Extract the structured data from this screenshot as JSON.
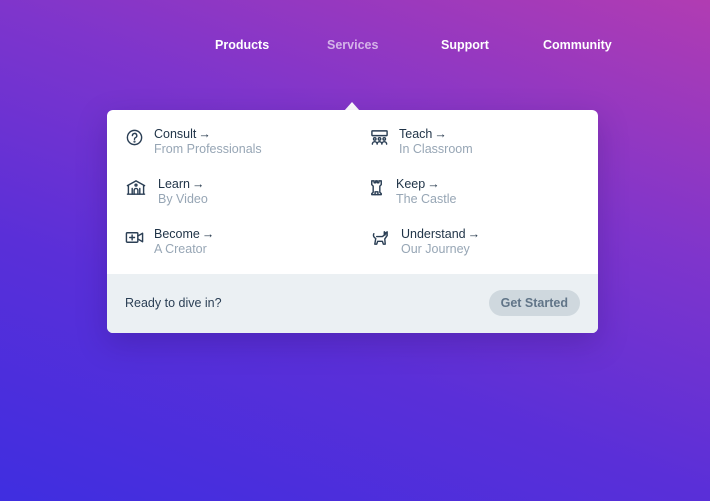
{
  "nav": {
    "items": [
      {
        "label": "Products"
      },
      {
        "label": "Services",
        "active": true
      },
      {
        "label": "Support"
      },
      {
        "label": "Community"
      }
    ]
  },
  "dropdown": {
    "items": [
      {
        "title": "Consult",
        "subtitle": "From Professionals",
        "icon": "question-circle-icon"
      },
      {
        "title": "Teach",
        "subtitle": "In Classroom",
        "icon": "classroom-icon"
      },
      {
        "title": "Learn",
        "subtitle": "By Video",
        "icon": "museum-icon"
      },
      {
        "title": "Keep",
        "subtitle": "The Castle",
        "icon": "castle-tower-icon"
      },
      {
        "title": "Become",
        "subtitle": "A Creator",
        "icon": "video-plus-icon"
      },
      {
        "title": "Understand",
        "subtitle": "Our Journey",
        "icon": "cat-icon"
      }
    ],
    "arrow": "→",
    "footer": {
      "text": "Ready to dive in?",
      "button": "Get Started"
    }
  },
  "colors": {
    "text_dark": "#1f3347",
    "text_muted": "#97a6b5",
    "footer_bg": "#ebf0f3",
    "button_bg": "#cfd8de"
  }
}
